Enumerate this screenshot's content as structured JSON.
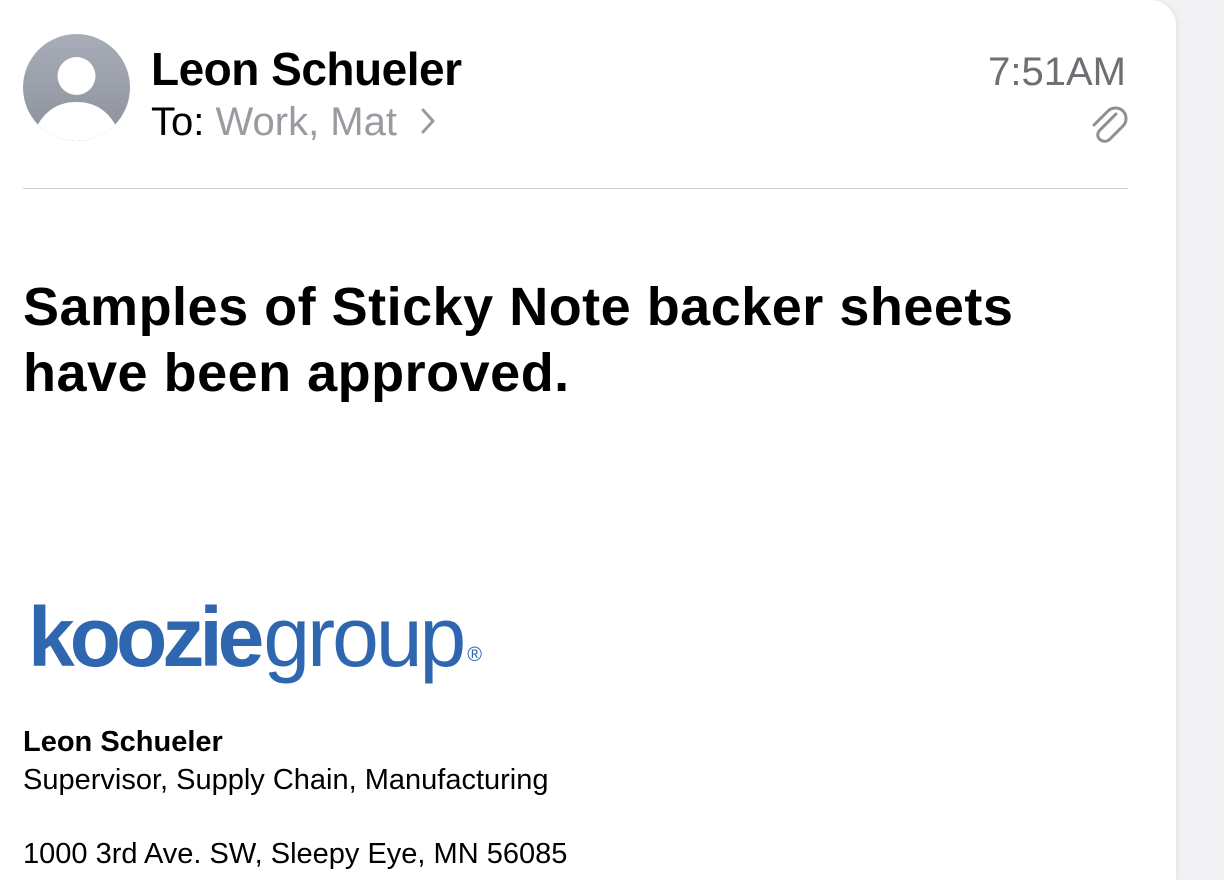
{
  "header": {
    "sender": "Leon Schueler",
    "to_label": "To:",
    "recipients": "Work, Mat",
    "time": "7:51AM"
  },
  "icons": {
    "avatar": "person-avatar-icon",
    "chevron": "chevron-right-icon",
    "attachment": "paperclip-icon"
  },
  "message": {
    "subject": "Samples of Sticky Note backer sheets have been approved."
  },
  "signature": {
    "logo_bold": "koozie",
    "logo_light": "group",
    "logo_mark": "®",
    "name": "Leon Schueler",
    "title": "Supervisor, Supply Chain, Manufacturing",
    "address": "1000 3rd Ave. SW, Sleepy Eye, MN  56085"
  },
  "colors": {
    "brand": "#2e66b0",
    "secondary_text": "#9a9aa0",
    "time_text": "#6e6e73"
  }
}
